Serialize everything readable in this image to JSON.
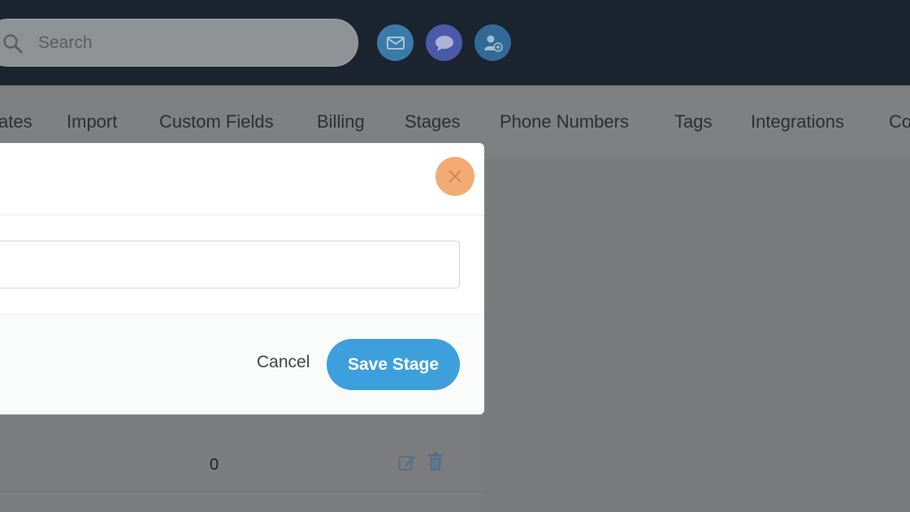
{
  "header": {
    "search": {
      "placeholder": "Search",
      "value": ""
    },
    "icons": [
      "mail-icon",
      "chat-icon",
      "add-user-icon"
    ],
    "colors": {
      "bar": "#1c2430"
    }
  },
  "nav": {
    "tabs": [
      {
        "label": "ates"
      },
      {
        "label": "Import"
      },
      {
        "label": "Custom Fields"
      },
      {
        "label": "Billing"
      },
      {
        "label": "Stages"
      },
      {
        "label": "Phone Numbers"
      },
      {
        "label": "Tags"
      },
      {
        "label": "Integrations"
      },
      {
        "label": "Co"
      }
    ]
  },
  "background": {
    "row_count": "0"
  },
  "modal": {
    "field_value": "",
    "cancel_label": "Cancel",
    "save_label": "Save Stage",
    "colors": {
      "save": "#3d9fdb",
      "close": "#f4ab73"
    }
  }
}
